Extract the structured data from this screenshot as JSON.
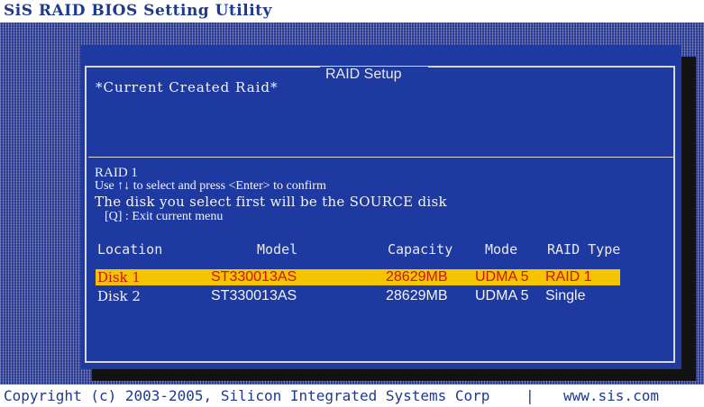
{
  "app": {
    "title": "SiS RAID BIOS Setting Utility"
  },
  "dialog": {
    "title": "RAID Setup",
    "current_label": "*Current Created Raid*",
    "raid_level": "RAID 1",
    "instruction": "Use ↑↓ to select and press <Enter> to confirm",
    "source_hint": "The disk you select first will be the SOURCE disk",
    "exit_hint": "[Q] : Exit current menu"
  },
  "table": {
    "headers": [
      "Location",
      "Model",
      "Capacity",
      "Mode",
      "RAID Type"
    ],
    "rows": [
      {
        "location": "Disk 1",
        "model": "ST330013AS",
        "capacity": "28629MB",
        "mode": "UDMA 5",
        "raid_type": "RAID 1",
        "selected": true
      },
      {
        "location": "Disk 2",
        "model": "ST330013AS",
        "capacity": "28629MB",
        "mode": "UDMA 5",
        "raid_type": "Single",
        "selected": false
      }
    ]
  },
  "footer": {
    "copyright": "Copyright (c) 2003-2005, Silicon Integrated Systems Corp",
    "separator": "|",
    "url": "www.sis.com"
  },
  "colors": {
    "background_blue": "#2a3a90",
    "dialog_blue": "#1e3aa0",
    "highlight": "#f5c400",
    "highlight_text": "#c8141a",
    "title_text": "#1e3a8f"
  }
}
